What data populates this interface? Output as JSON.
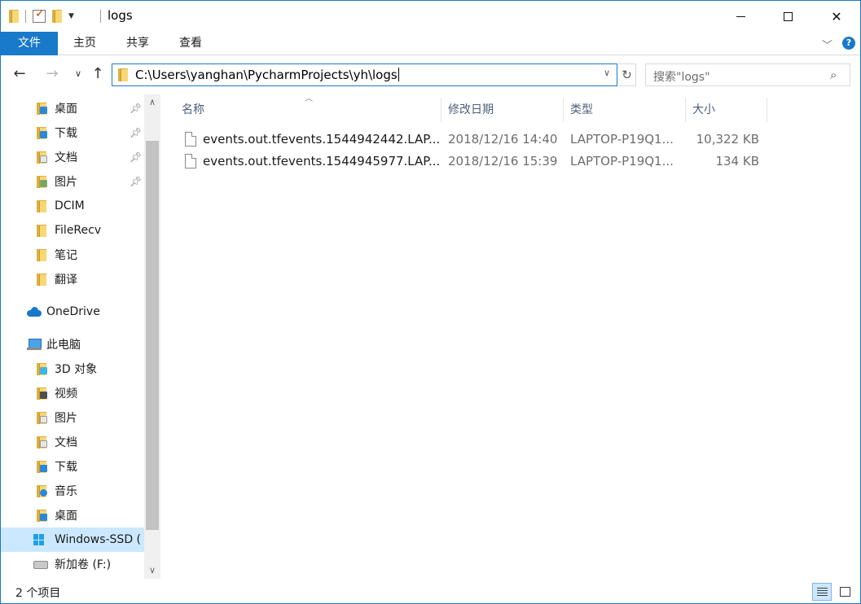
{
  "window": {
    "title": "logs",
    "minimize_label": "",
    "maximize_label": "",
    "close_label": "✕"
  },
  "ribbon": {
    "tabs": [
      "文件",
      "主页",
      "共享",
      "查看"
    ],
    "expand_glyph": "﹀",
    "help_glyph": "?"
  },
  "address": {
    "path": "C:\\Users\\yanghan\\PycharmProjects\\yh\\logs",
    "search_placeholder": "搜索\"logs\""
  },
  "nav_pane": {
    "quick_access": [
      {
        "label": "桌面",
        "icon": "desktop-folder-icon",
        "pinned": true
      },
      {
        "label": "下载",
        "icon": "download-folder-icon",
        "pinned": true
      },
      {
        "label": "文档",
        "icon": "documents-folder-icon",
        "pinned": true
      },
      {
        "label": "图片",
        "icon": "pictures-folder-icon",
        "pinned": true
      },
      {
        "label": "DCIM",
        "icon": "folder-icon",
        "pinned": false
      },
      {
        "label": "FileRecv",
        "icon": "folder-icon",
        "pinned": false
      },
      {
        "label": "笔记",
        "icon": "folder-icon",
        "pinned": false
      },
      {
        "label": "翻译",
        "icon": "folder-icon",
        "pinned": false
      }
    ],
    "onedrive": {
      "label": "OneDrive",
      "icon": "onedrive-cloud-icon"
    },
    "this_pc": {
      "label": "此电脑",
      "icon": "this-pc-icon"
    },
    "pc_items": [
      {
        "label": "3D 对象",
        "icon": "3d-objects-folder-icon"
      },
      {
        "label": "视频",
        "icon": "videos-folder-icon"
      },
      {
        "label": "图片",
        "icon": "pictures-folder-icon"
      },
      {
        "label": "文档",
        "icon": "documents-folder-icon"
      },
      {
        "label": "下载",
        "icon": "download-folder-icon"
      },
      {
        "label": "音乐",
        "icon": "music-folder-icon"
      },
      {
        "label": "桌面",
        "icon": "desktop-folder-icon"
      },
      {
        "label": "Windows-SSD (",
        "icon": "windows-drive-icon",
        "selected": true
      },
      {
        "label": "新加卷 (F:)",
        "icon": "drive-icon"
      }
    ]
  },
  "file_list": {
    "columns": [
      "名称",
      "修改日期",
      "类型",
      "大小"
    ],
    "rows": [
      {
        "name": "events.out.tfevents.1544942442.LAP...",
        "modified": "2018/12/16 14:40",
        "type": "LAPTOP-P19Q1...",
        "size": "10,322 KB"
      },
      {
        "name": "events.out.tfevents.1544945977.LAP...",
        "modified": "2018/12/16 15:39",
        "type": "LAPTOP-P19Q1...",
        "size": "134 KB"
      }
    ]
  },
  "status": {
    "item_count": "2 个项目"
  },
  "colors": {
    "accent": "#1979ca",
    "selection": "#cce8ff",
    "folder": "#f8d775"
  }
}
